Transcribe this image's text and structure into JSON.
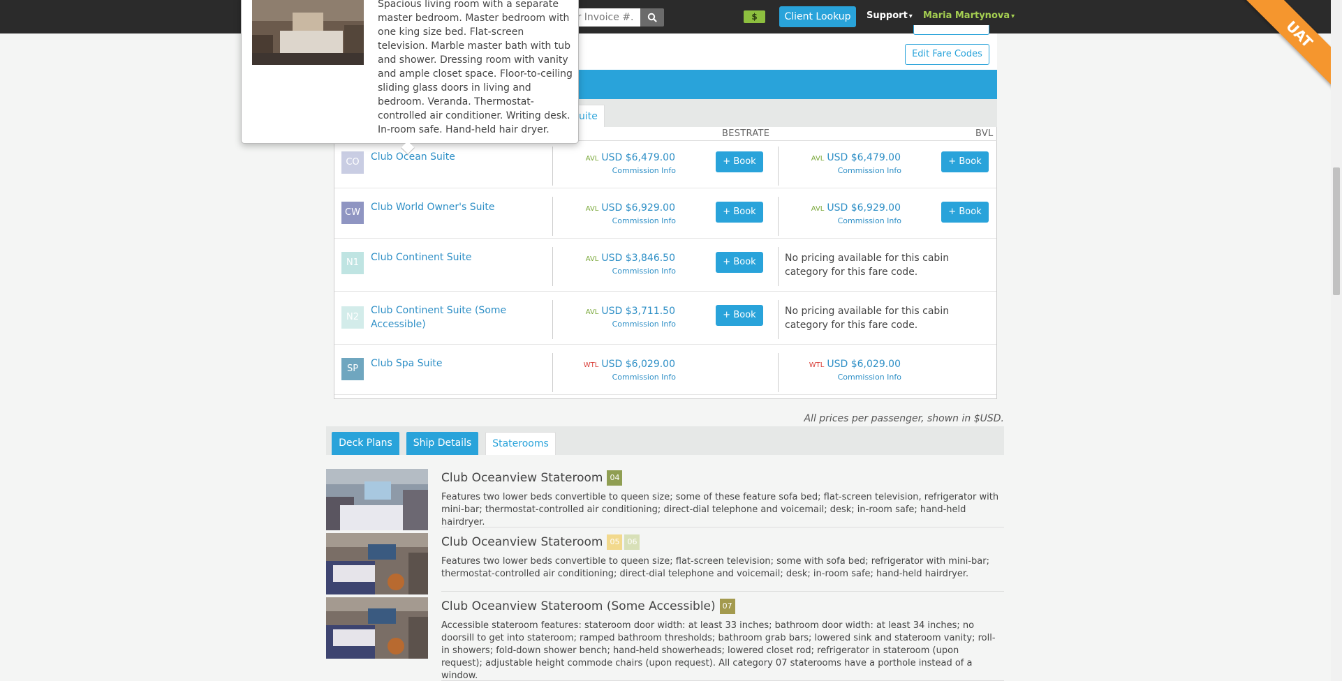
{
  "topbar": {
    "search_placeholder": "or Invoice #.",
    "dollar_label": "$",
    "client_lookup": "Client Lookup",
    "support": "Support",
    "user_name": "Maria Martynova",
    "env_ribbon": "UAT"
  },
  "fare_panel": {
    "edit_fare_codes": "Edit Fare Codes",
    "tab_partial": "uite",
    "columns": [
      "BESTRATE",
      "BVL"
    ],
    "rows": [
      {
        "code": "CO",
        "code_color": "#c9cde3",
        "name": "Club Ocean Suite",
        "col1": {
          "status": "AVL",
          "price": "USD $6,479.00",
          "commission": "Commission Info",
          "book": "+ Book"
        },
        "col2": {
          "status": "AVL",
          "price": "USD $6,479.00",
          "commission": "Commission Info",
          "book": "+ Book"
        }
      },
      {
        "code": "CW",
        "code_color": "#8f95c2",
        "name": "Club World Owner's Suite",
        "col1": {
          "status": "AVL",
          "price": "USD $6,929.00",
          "commission": "Commission Info",
          "book": "+ Book"
        },
        "col2": {
          "status": "AVL",
          "price": "USD $6,929.00",
          "commission": "Commission Info",
          "book": "+ Book"
        }
      },
      {
        "code": "N1",
        "code_color": "#bfe4e2",
        "name": "Club Continent Suite",
        "col1": {
          "status": "AVL",
          "price": "USD $3,846.50",
          "commission": "Commission Info",
          "book": "+ Book"
        },
        "col2_text": "No pricing available for this cabin category for this fare code."
      },
      {
        "code": "N2",
        "code_color": "#d3ecea",
        "name": "Club Continent Suite (Some Accessible)",
        "col1": {
          "status": "AVL",
          "price": "USD $3,711.50",
          "commission": "Commission Info",
          "book": "+ Book"
        },
        "col2_text": "No pricing available for this cabin category for this fare code."
      },
      {
        "code": "SP",
        "code_color": "#6fa6bf",
        "name": "Club Spa Suite",
        "col1": {
          "status": "WTL",
          "price": "USD $6,029.00",
          "commission": "Commission Info"
        },
        "col2": {
          "status": "WTL",
          "price": "USD $6,029.00",
          "commission": "Commission Info"
        }
      }
    ],
    "prices_note": "All prices per passenger, shown in $USD."
  },
  "ship_tabs": [
    "Deck Plans",
    "Ship Details",
    "Staterooms"
  ],
  "staterooms": [
    {
      "title": "Club Oceanview Stateroom",
      "decks": [
        {
          "label": "04",
          "color": "#8f9e52"
        }
      ],
      "desc": "Features two lower beds convertible to queen size; some of these feature sofa bed; flat-screen television, refrigerator with mini-bar; thermostat-controlled air conditioning; direct-dial telephone and voicemail; desk; in-room safe; hand-held hairdryer."
    },
    {
      "title": "Club Oceanview Stateroom",
      "decks": [
        {
          "label": "05",
          "color": "#f2d98d"
        },
        {
          "label": "06",
          "color": "#d8e0b8"
        }
      ],
      "desc": "Features two lower beds convertible to queen size; flat-screen television; some with sofa bed; refrigerator with mini-bar; thermostat-controlled air conditioning; direct-dial telephone and voicemail; desk; in-room safe; hand-held hairdryer."
    },
    {
      "title": "Club Oceanview Stateroom (Some Accessible)",
      "decks": [
        {
          "label": "07",
          "color": "#a39a4e"
        }
      ],
      "desc": "Accessible stateroom features: stateroom door width: at least 33 inches; bathroom door width: at least 34 inches; no doorsill to get into stateroom; ramped bathroom thresholds; bathroom grab bars; lowered sink and stateroom vanity; roll-in showers; fold-down shower bench; hand-held showerheads; lowered closet rod; refrigerator in stateroom (upon request); adjustable height commode chairs (upon request). All category 07 staterooms have a porthole instead of a window."
    }
  ],
  "popover": {
    "text": "Spacious living room with a separate master bedroom. Master bedroom with one king size bed. Flat-screen television. Marble master bath with tub and shower. Dressing room with vanity and ample closet space. Floor-to-ceiling sliding glass doors in living and bedroom. Veranda. Thermostat-controlled air conditioner. Writing desk. In-room safe. Hand-held hair dryer."
  }
}
